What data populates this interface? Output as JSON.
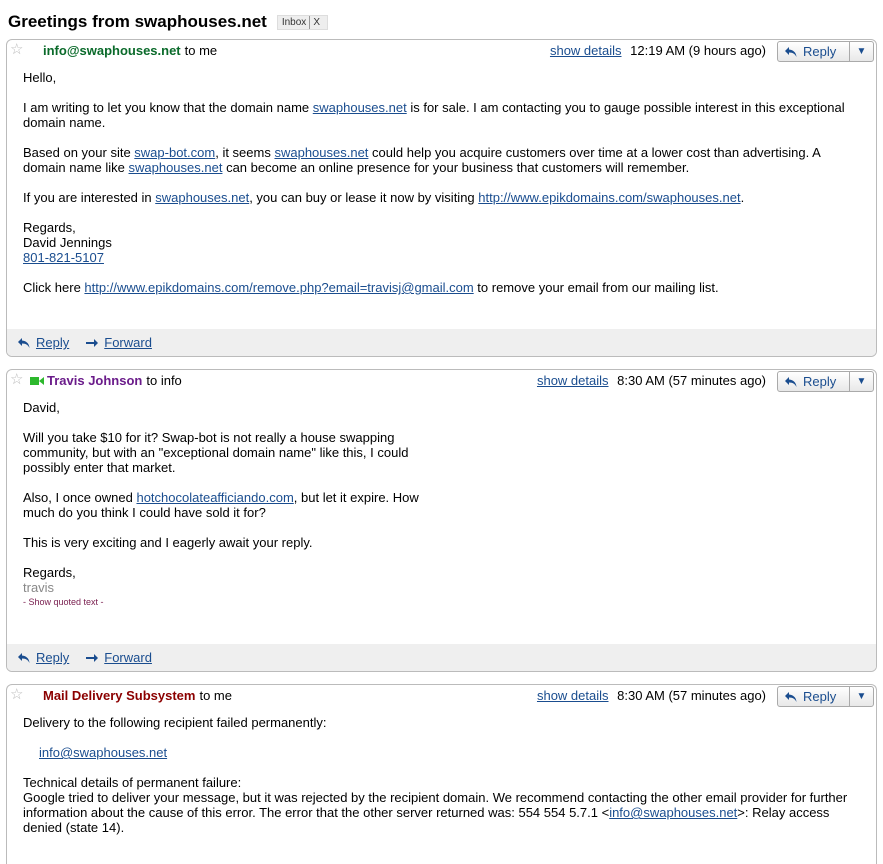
{
  "thread": {
    "title": "Greetings from swaphouses.net",
    "label": "Inbox",
    "label_remove": "X"
  },
  "common": {
    "show_details": "show details",
    "reply": "Reply",
    "forward": "Forward"
  },
  "messages": [
    {
      "sender": "info@swaphouses.net",
      "to": "to me",
      "time": "12:19 AM (9 hours ago)",
      "lines": {
        "greeting": "Hello,",
        "p1a": "I am writing to let you know that the domain name ",
        "p1link": "swaphouses.net",
        "p1b": " is for sale. I am contacting you to gauge possible interest in this exceptional domain name.",
        "p2a": "Based on your site ",
        "p2link1": "swap-bot.com",
        "p2b": ", it seems ",
        "p2link2": "swaphouses.net",
        "p2c": " could help you acquire customers over time at a lower cost than advertising. A domain name like ",
        "p2link3": "swaphouses.net",
        "p2d": " can become an online presence for your business that customers will remember.",
        "p3a": "If you are interested in ",
        "p3link1": "swaphouses.net",
        "p3b": ", you can buy or lease it now by visiting ",
        "p3link2": "http://www.epikdomains.com/swaphouses.net",
        "p3c": ".",
        "regards": "Regards,",
        "name": "David Jennings",
        "phone": "801-821-5107",
        "p5a": "Click here ",
        "p5link": "http://www.epikdomains.com/remove.php?email=travisj@gmail.com",
        "p5b": " to remove your email from our mailing list."
      }
    },
    {
      "sender": "Travis Johnson",
      "to": "to info",
      "time": "8:30 AM (57 minutes ago)",
      "lines": {
        "greeting": "David,",
        "p1": "Will you take $10 for it? Swap-bot is not really a house swapping community, but with an \"exceptional domain name\" like this, I could possibly enter that market.",
        "p2a": "Also, I once owned ",
        "p2link": "hotchocolateafficiando.com",
        "p2b": ", but let it expire. How much do you think I could have sold it for?",
        "p3": "This is very exciting and I eagerly await your reply.",
        "regards": "Regards,",
        "sig": "travis",
        "quoted": "- Show quoted text -"
      }
    },
    {
      "sender": "Mail Delivery Subsystem",
      "to": "to me",
      "time": "8:30 AM (57 minutes ago)",
      "lines": {
        "p1": "Delivery to the following recipient failed permanently:",
        "recipient": "info@swaphouses.net",
        "p3title": "Technical details of permanent failure:",
        "p3a": "Google tried to deliver your message, but it was rejected by the recipient domain. We recommend contacting the other email provider for further information about the cause of this error. The error that the other server returned was: 554 554 5.7.1 <",
        "p3link": "info@swaphouses.net",
        "p3b": ">: Relay access denied (state 14)."
      }
    }
  ]
}
